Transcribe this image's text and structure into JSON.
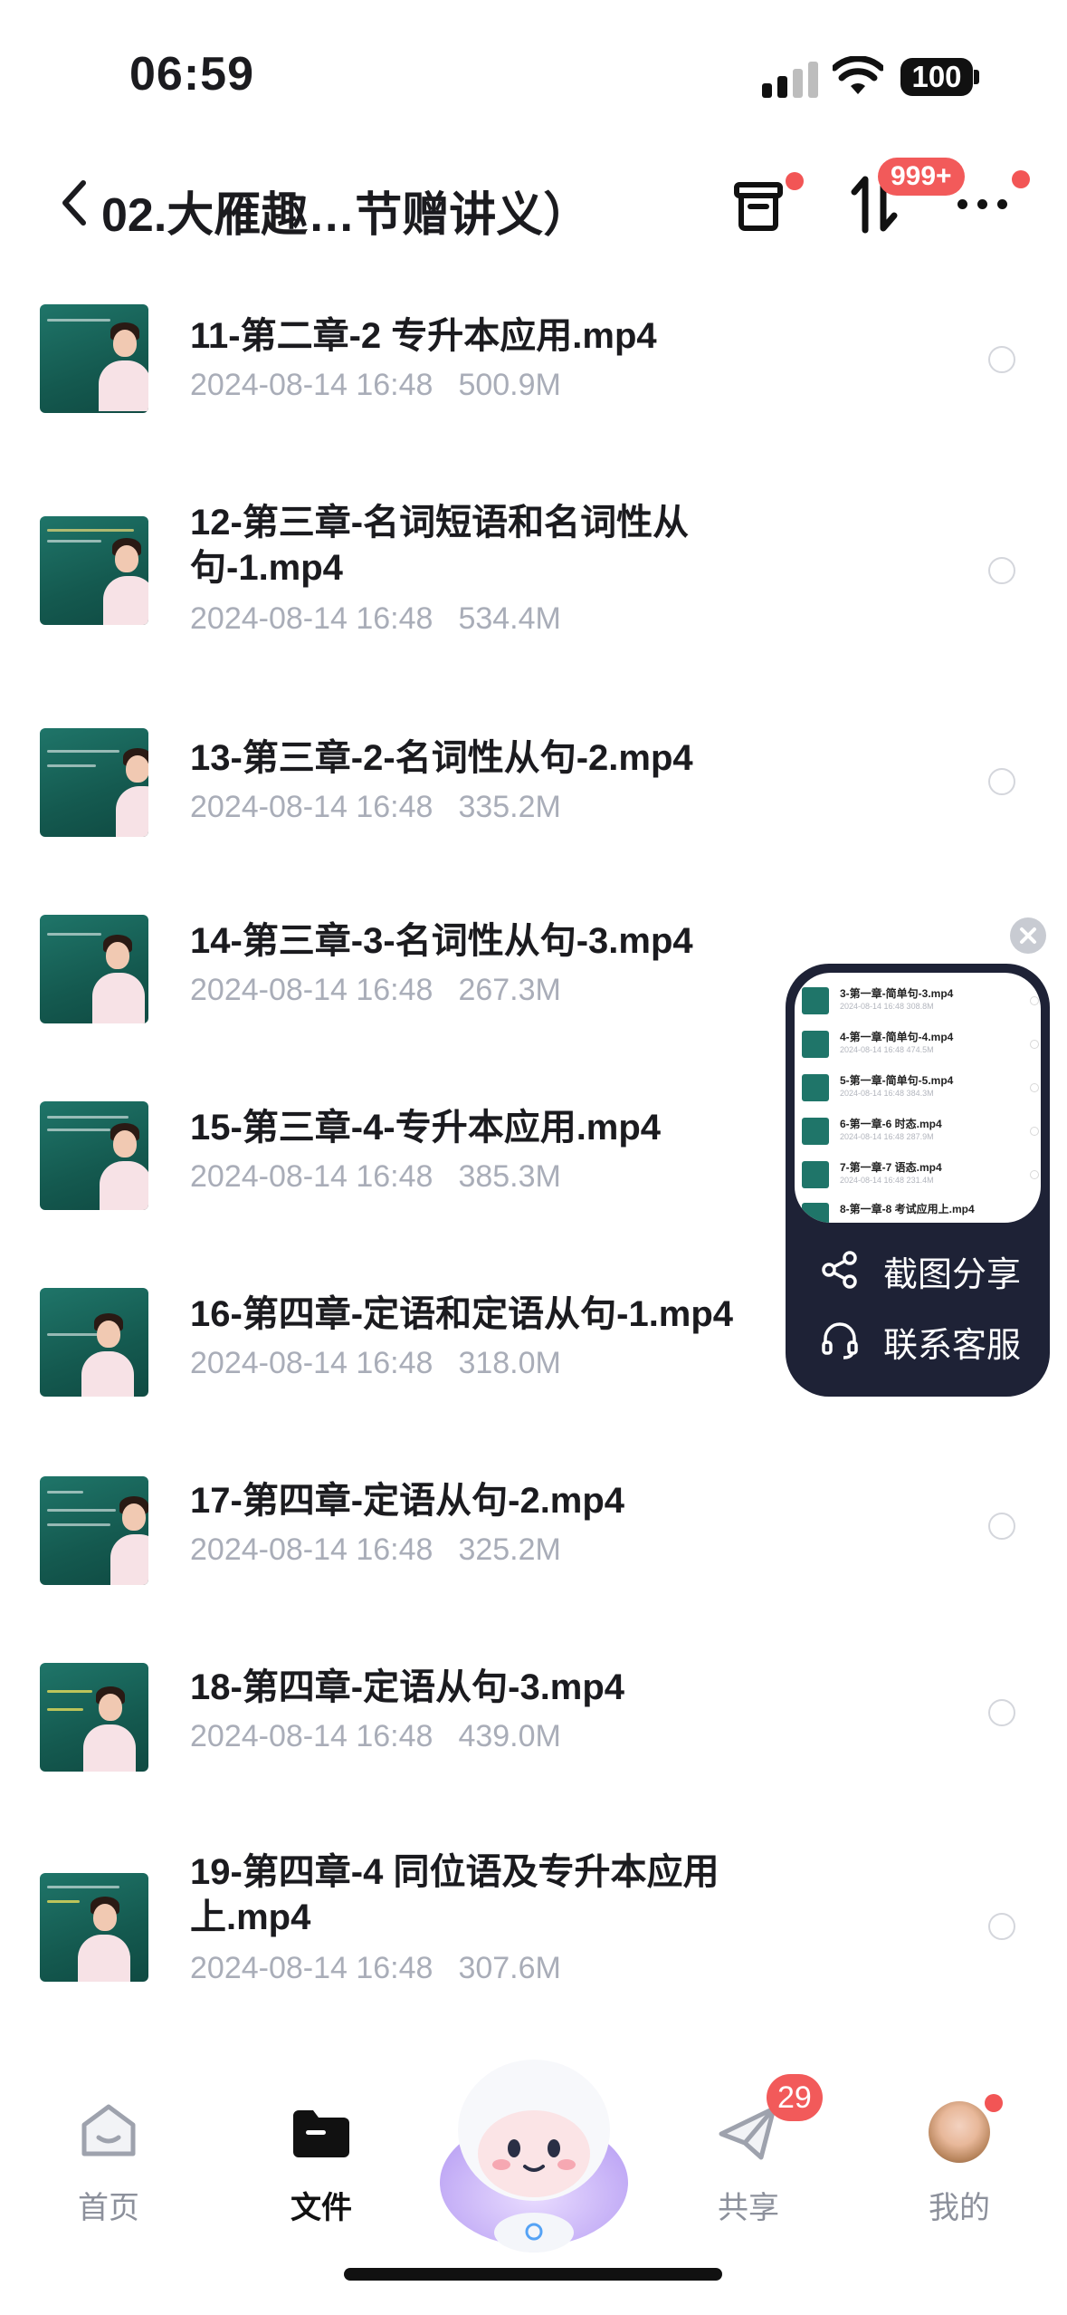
{
  "status_bar": {
    "time": "06:59",
    "battery": "100"
  },
  "header": {
    "title": "02.大雁趣…节赠讲义）",
    "transfer_badge": "999+"
  },
  "files": [
    {
      "name": "11-第二章-2 专升本应用.mp4",
      "date": "2024-08-14 16:48",
      "size": "500.9M"
    },
    {
      "name": "12-第三章-名词短语和名词性从句-1.mp4",
      "date": "2024-08-14 16:48",
      "size": "534.4M"
    },
    {
      "name": "13-第三章-2-名词性从句-2.mp4",
      "date": "2024-08-14 16:48",
      "size": "335.2M"
    },
    {
      "name": "14-第三章-3-名词性从句-3.mp4",
      "date": "2024-08-14 16:48",
      "size": "267.3M"
    },
    {
      "name": "15-第三章-4-专升本应用.mp4",
      "date": "2024-08-14 16:48",
      "size": "385.3M"
    },
    {
      "name": "16-第四章-定语和定语从句-1.mp4",
      "date": "2024-08-14 16:48",
      "size": "318.0M"
    },
    {
      "name": "17-第四章-定语从句-2.mp4",
      "date": "2024-08-14 16:48",
      "size": "325.2M"
    },
    {
      "name": "18-第四章-定语从句-3.mp4",
      "date": "2024-08-14 16:48",
      "size": "439.0M"
    },
    {
      "name": "19-第四章-4 同位语及专升本应用上.mp4",
      "date": "2024-08-14 16:48",
      "size": "307.6M"
    }
  ],
  "floating_panel": {
    "preview_items": [
      {
        "name": "3-第一章-简单句-3.mp4",
        "meta": "2024-08-14 16:48  308.8M"
      },
      {
        "name": "4-第一章-简单句-4.mp4",
        "meta": "2024-08-14 16:48  474.5M"
      },
      {
        "name": "5-第一章-简单句-5.mp4",
        "meta": "2024-08-14 16:48  384.3M"
      },
      {
        "name": "6-第一章-6 时态.mp4",
        "meta": "2024-08-14 16:48  287.9M"
      },
      {
        "name": "7-第一章-7 语态.mp4",
        "meta": "2024-08-14 16:48  231.4M"
      },
      {
        "name": "8-第一章-8 考试应用上.mp4",
        "meta": ""
      }
    ],
    "screenshot_share": "截图分享",
    "contact_service": "联系客服"
  },
  "tabbar": {
    "home": "首页",
    "files": "文件",
    "share": "共享",
    "share_badge": "29",
    "mine": "我的"
  },
  "colors": {
    "accent_red": "#f25a5a",
    "thumbnail_green": "#1f7569",
    "panel_dark": "#1e2236"
  }
}
